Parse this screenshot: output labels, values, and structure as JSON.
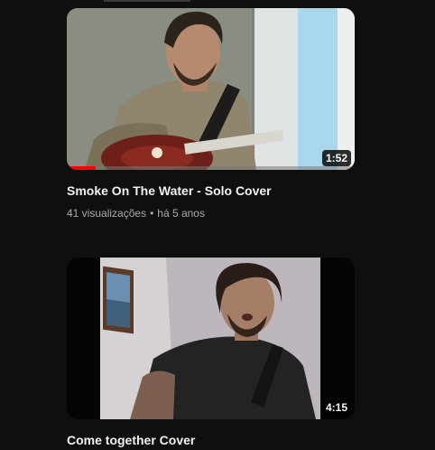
{
  "videos": [
    {
      "title": "Smoke On The Water - Solo Cover",
      "duration": "1:52",
      "views": "41 visualizações",
      "separator": "•",
      "age": "há 5 anos",
      "watch_progress": 0.1,
      "thumbnail_icon": "guitarist-thumbnail"
    },
    {
      "title": "Come together Cover",
      "duration": "4:15",
      "thumbnail_icon": "singer-thumbnail"
    }
  ],
  "colors": {
    "background": "#0f0f0f",
    "progress": "#ff0000",
    "meta_text": "#aaaaaa",
    "title_text": "#f1f1f1"
  }
}
